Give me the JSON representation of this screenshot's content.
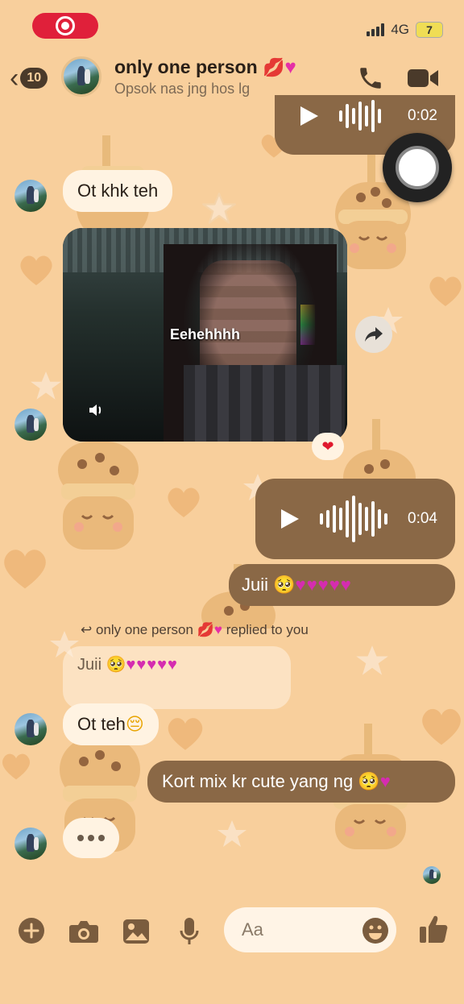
{
  "status_bar": {
    "network": "4G",
    "battery": "7"
  },
  "header": {
    "back_count": "10",
    "title": "only one person",
    "subtitle": "Opsok nas jng hos lg"
  },
  "messages": {
    "audio1_duration": "0:02",
    "m1": "Ot khk teh",
    "video_caption": "Eehehhhh",
    "video_reaction": "❤",
    "audio2_duration": "0:04",
    "m2_text": "Juii",
    "reply_label_prefix": "only one person",
    "reply_label_suffix": "replied to you",
    "quoted_text": "Juii",
    "m3": "Ot teh",
    "m4": "Kort mix kr cute yang ng"
  },
  "composer": {
    "placeholder": "Aa"
  },
  "colors": {
    "background": "#f8cf9c",
    "sent_bubble": "#8a6846",
    "received_bubble": "#fff3e2",
    "accent": "#4a3a2a"
  },
  "icons": [
    "record-indicator-icon",
    "back-icon",
    "phone-icon",
    "video-call-icon",
    "speaker-icon",
    "share-icon",
    "plus-icon",
    "camera-icon",
    "gallery-icon",
    "microphone-icon",
    "emoji-icon",
    "thumbs-up-icon"
  ]
}
